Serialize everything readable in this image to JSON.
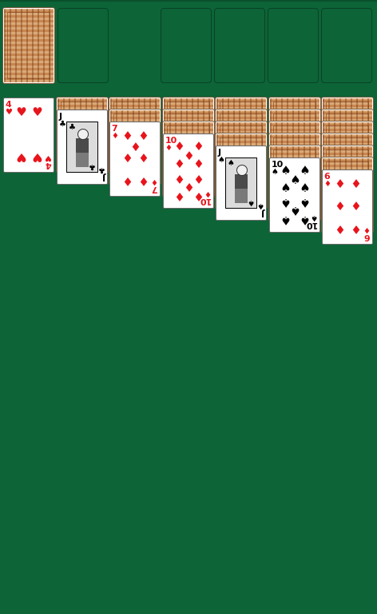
{
  "game": {
    "stock": {
      "face_down": true,
      "card_back": "wood-pattern-back"
    },
    "foundations": [
      {
        "empty": true
      },
      {
        "empty": true
      },
      {
        "empty": true
      },
      {
        "empty": true
      }
    ],
    "tableau": [
      {
        "face_down_count": 0,
        "top_card": {
          "rank": "4",
          "suit": "hearts",
          "symbol": "♥",
          "color": "#e8141c"
        }
      },
      {
        "face_down_count": 1,
        "top_card": {
          "rank": "J",
          "suit": "clubs",
          "symbol": "♣",
          "color": "#000000"
        }
      },
      {
        "face_down_count": 2,
        "top_card": {
          "rank": "7",
          "suit": "diamonds",
          "symbol": "♦",
          "color": "#e8141c"
        }
      },
      {
        "face_down_count": 3,
        "top_card": {
          "rank": "10",
          "suit": "diamonds",
          "symbol": "♦",
          "color": "#e8141c"
        }
      },
      {
        "face_down_count": 4,
        "top_card": {
          "rank": "J",
          "suit": "spades",
          "symbol": "♠",
          "color": "#000000"
        }
      },
      {
        "face_down_count": 5,
        "top_card": {
          "rank": "10",
          "suit": "spades",
          "symbol": "♠",
          "color": "#000000"
        }
      },
      {
        "face_down_count": 6,
        "top_card": {
          "rank": "6",
          "suit": "diamonds",
          "symbol": "♦",
          "color": "#e8141c"
        }
      }
    ]
  },
  "colors": {
    "table": "#0c6437",
    "slot_border": "#0a4324",
    "red": "#e8141c",
    "black": "#000000"
  }
}
